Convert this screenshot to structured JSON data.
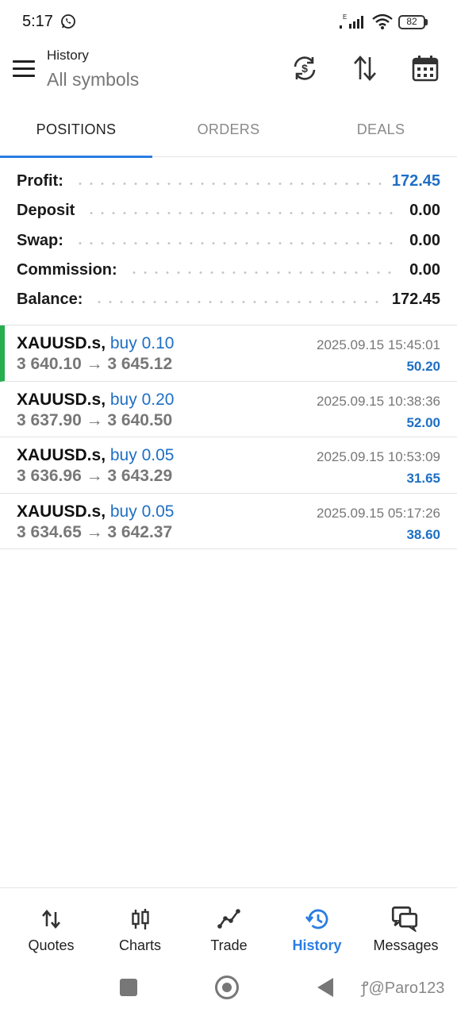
{
  "status_bar": {
    "time": "5:17",
    "battery": "82",
    "icons": [
      "whatsapp-icon",
      "signal-icon",
      "wifi-icon",
      "battery-icon"
    ]
  },
  "header": {
    "title": "History",
    "subtitle": "All symbols",
    "icons": [
      "menu-icon",
      "sync-currency-icon",
      "sort-icon",
      "calendar-icon"
    ]
  },
  "tabs": [
    {
      "label": "POSITIONS",
      "active": true
    },
    {
      "label": "ORDERS",
      "active": false
    },
    {
      "label": "DEALS",
      "active": false
    }
  ],
  "summary": [
    {
      "label": "Profit:",
      "value": "172.45"
    },
    {
      "label": "Deposit",
      "value": "0.00"
    },
    {
      "label": "Swap:",
      "value": "0.00"
    },
    {
      "label": "Commission:",
      "value": "0.00"
    },
    {
      "label": "Balance:",
      "value": "172.45"
    }
  ],
  "deals": [
    {
      "symbol": "XAUUSD.s,",
      "side": "buy 0.10",
      "prices": "3 640.10 → 3 645.12",
      "time": "2025.09.15 15:45:01",
      "profit": "50.20"
    },
    {
      "symbol": "XAUUSD.s,",
      "side": "buy 0.20",
      "prices": "3 637.90 → 3 640.50",
      "time": "2025.09.15 10:38:36",
      "profit": "52.00"
    },
    {
      "symbol": "XAUUSD.s,",
      "side": "buy 0.05",
      "prices": "3 636.96 → 3 643.29",
      "time": "2025.09.15 10:53:09",
      "profit": "31.65"
    },
    {
      "symbol": "XAUUSD.s,",
      "side": "buy 0.05",
      "prices": "3 634.65 → 3 642.37",
      "time": "2025.09.15 05:17:26",
      "profit": "38.60"
    }
  ],
  "bottom_nav": [
    {
      "label": "Quotes",
      "icon": "quotes-icon",
      "active": false
    },
    {
      "label": "Charts",
      "icon": "charts-icon",
      "active": false
    },
    {
      "label": "Trade",
      "icon": "trade-icon",
      "active": false
    },
    {
      "label": "History",
      "icon": "history-icon",
      "active": true
    },
    {
      "label": "Messages",
      "icon": "messages-icon",
      "active": false
    }
  ],
  "watermark": "@Paro123",
  "colors": {
    "accent": "#2a7de1",
    "value_blue": "#1e6fc4",
    "first_row_marker": "#27ae4f"
  }
}
